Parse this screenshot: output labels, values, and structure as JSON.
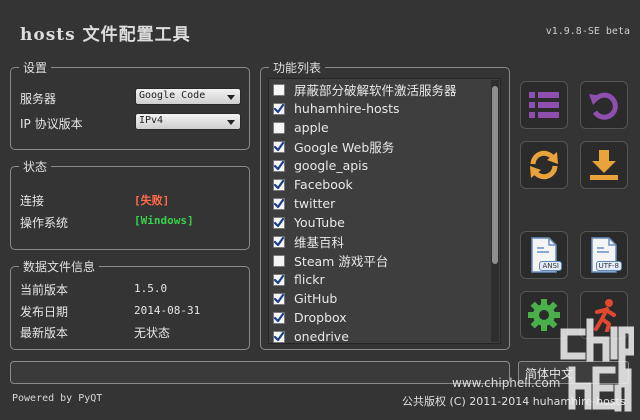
{
  "app": {
    "title": "hosts 文件配置工具",
    "version": "v1.9.8-SE beta"
  },
  "settings": {
    "title": "设置",
    "server_label": "服务器",
    "server_value": "Google Code",
    "ip_label": "IP 协议版本",
    "ip_value": "IPv4"
  },
  "status": {
    "title": "状态",
    "connection_label": "连接",
    "connection_value": "[失败]",
    "os_label": "操作系统",
    "os_value": "[Windows]"
  },
  "datafile": {
    "title": "数据文件信息",
    "current_label": "当前版本",
    "current_value": "1.5.0",
    "release_label": "发布日期",
    "release_value": "2014-08-31",
    "latest_label": "最新版本",
    "latest_value": "无状态"
  },
  "functions": {
    "title": "功能列表",
    "items": [
      {
        "label": "屏蔽部分破解软件激活服务器",
        "checked": false
      },
      {
        "label": "huhamhire-hosts",
        "checked": true
      },
      {
        "label": "apple",
        "checked": false
      },
      {
        "label": "Google Web服务",
        "checked": true
      },
      {
        "label": "google_apis",
        "checked": true
      },
      {
        "label": "Facebook",
        "checked": true
      },
      {
        "label": "twitter",
        "checked": true
      },
      {
        "label": "YouTube",
        "checked": true
      },
      {
        "label": "维基百科",
        "checked": true
      },
      {
        "label": "Steam 游戏平台",
        "checked": false
      },
      {
        "label": "flickr",
        "checked": true
      },
      {
        "label": "GitHub",
        "checked": true
      },
      {
        "label": "Dropbox",
        "checked": true
      },
      {
        "label": "onedrive",
        "checked": true
      }
    ]
  },
  "tools": {
    "ansi_tag": "ANSI",
    "utf8_tag": "UTF-8",
    "colors": {
      "purple": "#8e4fb0",
      "orange": "#e9a33a",
      "green": "#49b04a",
      "red": "#e2482f",
      "blue": "#4a7fc1"
    }
  },
  "footer": {
    "language": "简体中文",
    "powered": "Powered by PyQT",
    "copyright": "公共版权 (C) 2011-2014 huhamhire-hosts",
    "watermark": "www.chiphell.com"
  }
}
